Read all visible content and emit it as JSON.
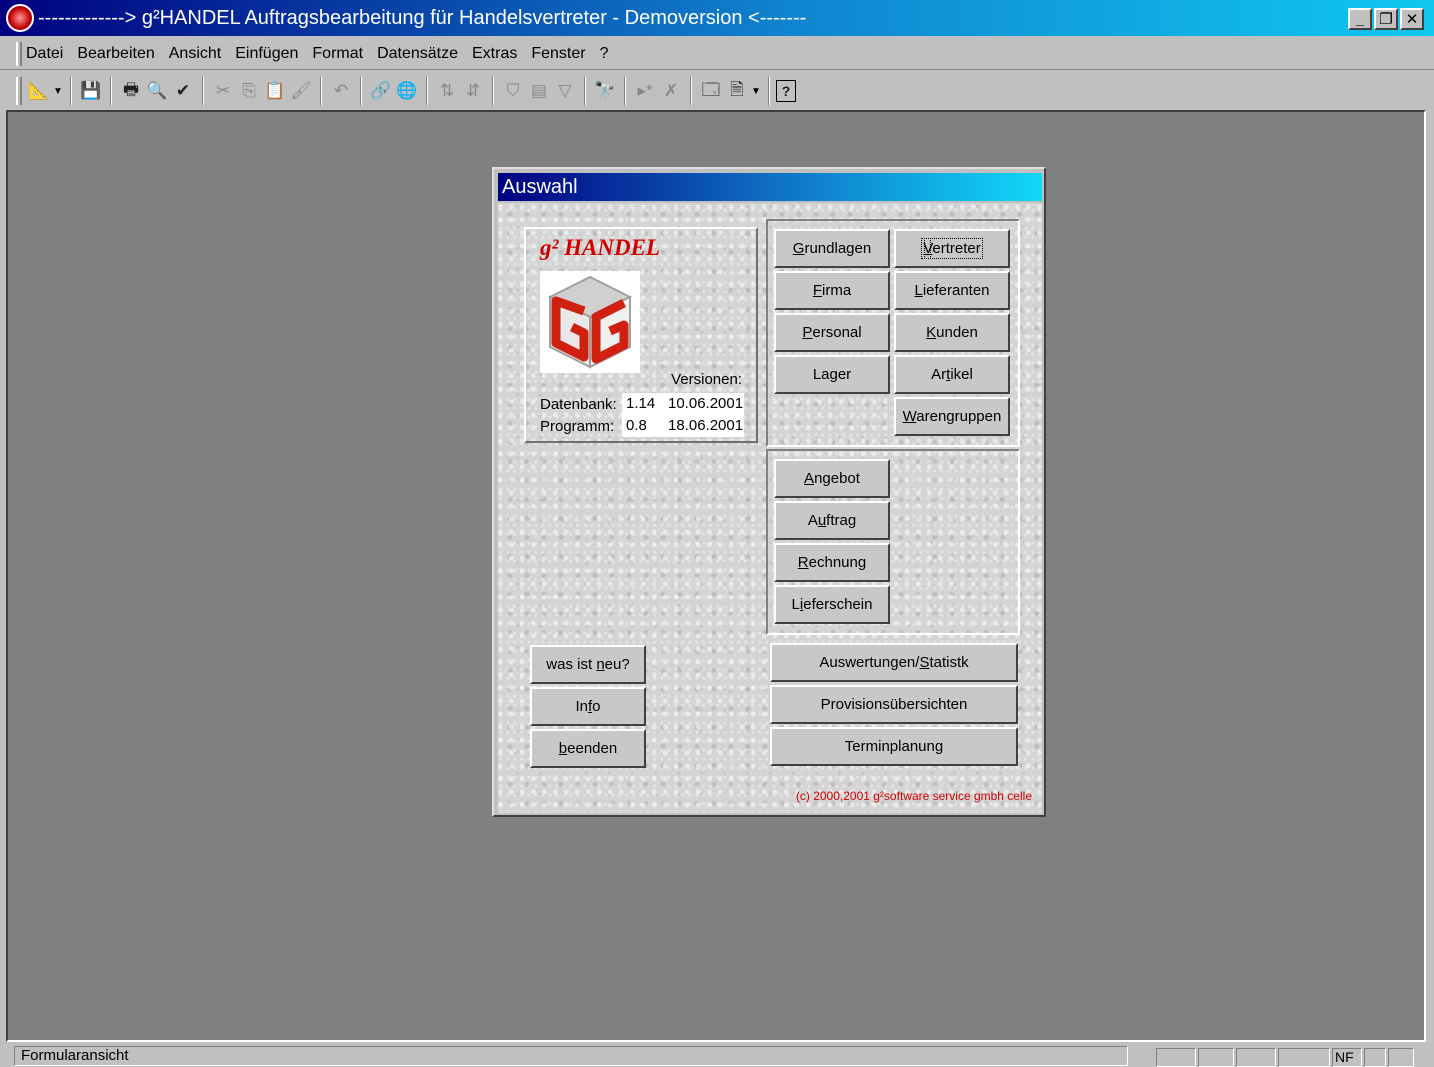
{
  "app": {
    "title": "-------------> g²HANDEL Auftragsbearbeitung für Handelsvertreter - Demoversion <-------",
    "window_controls": {
      "minimize": "_",
      "restore": "❐",
      "close": "✕"
    }
  },
  "menu": {
    "items": [
      "Datei",
      "Bearbeiten",
      "Ansicht",
      "Einfügen",
      "Format",
      "Datensätze",
      "Extras",
      "Fenster",
      "?"
    ]
  },
  "toolbar": {
    "icons": [
      {
        "name": "design-view-icon",
        "glyph": "📐"
      },
      {
        "name": "save-icon",
        "glyph": "💾"
      },
      {
        "name": "print-icon",
        "glyph": "🖶"
      },
      {
        "name": "print-preview-icon",
        "glyph": "🔍"
      },
      {
        "name": "spellcheck-icon",
        "glyph": "✔"
      },
      {
        "name": "cut-icon",
        "glyph": "✂"
      },
      {
        "name": "copy-icon",
        "glyph": "⎘"
      },
      {
        "name": "paste-icon",
        "glyph": "📋"
      },
      {
        "name": "format-painter-icon",
        "glyph": "🖌"
      },
      {
        "name": "undo-icon",
        "glyph": "↶"
      },
      {
        "name": "hyperlink-icon",
        "glyph": "🔗"
      },
      {
        "name": "web-icon",
        "glyph": "🌐"
      },
      {
        "name": "sort-ascending-icon",
        "glyph": "⇅"
      },
      {
        "name": "sort-descending-icon",
        "glyph": "⇵"
      },
      {
        "name": "filter-selection-icon",
        "glyph": "⛉"
      },
      {
        "name": "filter-form-icon",
        "glyph": "▤"
      },
      {
        "name": "apply-filter-icon",
        "glyph": "▽"
      },
      {
        "name": "find-icon",
        "glyph": "🔭"
      },
      {
        "name": "new-record-icon",
        "glyph": "▸*"
      },
      {
        "name": "delete-record-icon",
        "glyph": "✗"
      },
      {
        "name": "database-window-icon",
        "glyph": "🗔"
      },
      {
        "name": "new-object-icon",
        "glyph": "🗎"
      },
      {
        "name": "help-icon",
        "glyph": "?"
      }
    ]
  },
  "status": {
    "text": "Formularansicht",
    "indicator": "NF"
  },
  "form": {
    "title": "Auswahl",
    "brand": "g² HANDEL",
    "versions_label": "Versionen:",
    "db_label": "Datenbank:",
    "db_version": "1.14",
    "db_date": "10.06.2001",
    "prog_label": "Programm:",
    "prog_version": "0.8",
    "prog_date": "18.06.2001",
    "buttons_grid": [
      {
        "pre": "",
        "key": "G",
        "post": "rundlagen"
      },
      {
        "pre": "",
        "key": "V",
        "post": "ertreter"
      },
      {
        "pre": "",
        "key": "F",
        "post": "irma"
      },
      {
        "pre": "",
        "key": "L",
        "post": "ieferanten"
      },
      {
        "pre": "",
        "key": "P",
        "post": "ersonal"
      },
      {
        "pre": "",
        "key": "K",
        "post": "unden"
      },
      {
        "pre": "La",
        "key": "g",
        "post": "er"
      },
      {
        "pre": "Ar",
        "key": "t",
        "post": "ikel"
      },
      {
        "pre": "",
        "key": "W",
        "post": "arengruppen"
      }
    ],
    "buttons_docs": [
      {
        "pre": "",
        "key": "A",
        "post": "ngebot"
      },
      {
        "pre": "A",
        "key": "u",
        "post": "ftrag"
      },
      {
        "pre": "",
        "key": "R",
        "post": "echnung"
      },
      {
        "pre": "L",
        "key": "i",
        "post": "eferschein"
      }
    ],
    "buttons_left": [
      {
        "pre": "was ist ",
        "key": "n",
        "post": "eu?"
      },
      {
        "pre": "In",
        "key": "f",
        "post": "o"
      },
      {
        "pre": "",
        "key": "b",
        "post": "eenden"
      }
    ],
    "buttons_wide": [
      {
        "pre": "Auswertungen/",
        "key": "S",
        "post": "tatistk"
      },
      {
        "pre": "Provisionsübersichten",
        "key": "",
        "post": ""
      },
      {
        "pre": "Terminplanung",
        "key": "",
        "post": ""
      }
    ],
    "copyright": "(c) 2000,2001  g²software service gmbh celle"
  }
}
